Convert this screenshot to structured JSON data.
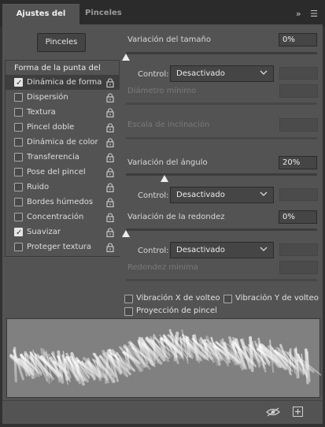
{
  "tabs": [
    {
      "label": "Ajustes del pincel",
      "active": true
    },
    {
      "label": "Pinceles",
      "active": false
    }
  ],
  "tab_menu": {
    "collapse_glyph": "»",
    "menu_glyph": "☰"
  },
  "brushes_button": "Pinceles",
  "categories_header": "Forma de la punta del pincel",
  "categories": [
    {
      "label": "Dinámica de forma",
      "checked": true,
      "selected": true,
      "locked": true
    },
    {
      "label": "Dispersión",
      "checked": false,
      "selected": false,
      "locked": true
    },
    {
      "label": "Textura",
      "checked": false,
      "selected": false,
      "locked": true
    },
    {
      "label": "Pincel doble",
      "checked": false,
      "selected": false,
      "locked": true
    },
    {
      "label": "Dinámica de color",
      "checked": false,
      "selected": false,
      "locked": true
    },
    {
      "label": "Transferencia",
      "checked": false,
      "selected": false,
      "locked": true
    },
    {
      "label": "Pose del pincel",
      "checked": false,
      "selected": false,
      "locked": true
    },
    {
      "label": "Ruido",
      "checked": false,
      "selected": false,
      "locked": true
    },
    {
      "label": "Bordes húmedos",
      "checked": false,
      "selected": false,
      "locked": true
    },
    {
      "label": "Concentración",
      "checked": false,
      "selected": false,
      "locked": true
    },
    {
      "label": "Suavizar",
      "checked": true,
      "selected": false,
      "locked": true
    },
    {
      "label": "Proteger textura",
      "checked": false,
      "selected": false,
      "locked": true
    }
  ],
  "size_jitter": {
    "label": "Variación del tamaño",
    "value": "0%",
    "slider_fraction": 0.0
  },
  "size_control": {
    "label": "Control:",
    "value": "Desactivado"
  },
  "min_diameter": {
    "label": "Diámetro mínimo"
  },
  "tilt_scale": {
    "label": "Escala de inclinación"
  },
  "angle_jitter": {
    "label": "Variación del ángulo",
    "value": "20%",
    "slider_fraction": 0.2
  },
  "angle_control": {
    "label": "Control:",
    "value": "Desactivado"
  },
  "roundness_jitter": {
    "label": "Variación de la redondez",
    "value": "0%",
    "slider_fraction": 0.0
  },
  "roundness_control": {
    "label": "Control:",
    "value": "Desactivado"
  },
  "min_roundness": {
    "label": "Redondez mínima"
  },
  "flip_x": {
    "label": "Vibración X de volteo",
    "checked": false
  },
  "flip_y": {
    "label": "Vibración Y de volteo",
    "checked": false
  },
  "brush_projection": {
    "label": "Proyección de pincel",
    "checked": false
  },
  "bottom_icons": [
    "toggle-preview-icon",
    "new-brush-icon"
  ],
  "colors": {
    "panel": "#535353",
    "tabbar": "#2b2b2b",
    "preview_bg": "#808080",
    "accent_text": "#ececec"
  }
}
